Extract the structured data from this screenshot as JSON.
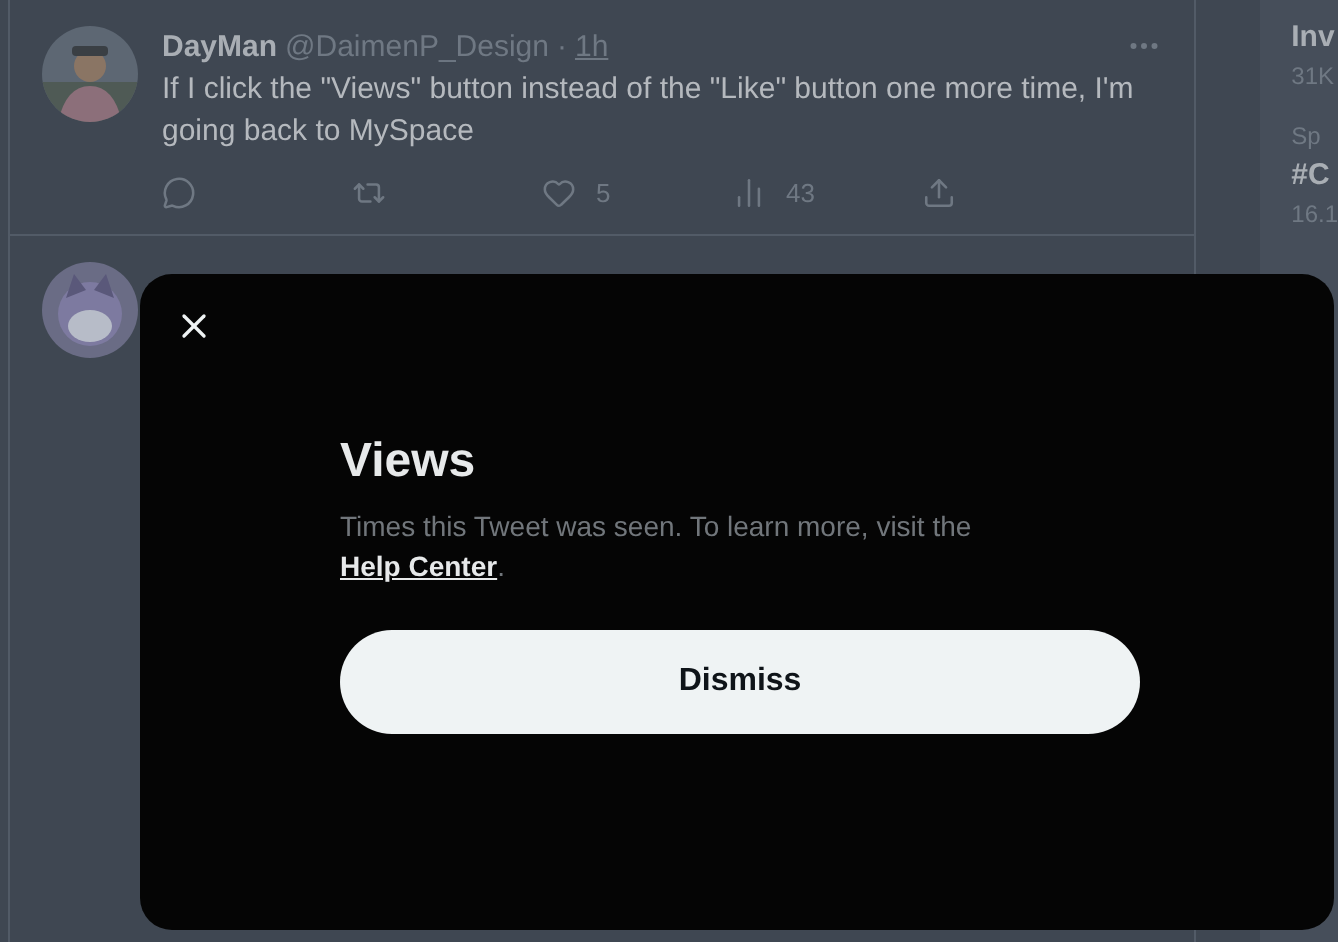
{
  "tweet": {
    "name": "DayMan",
    "handle": "@DaimenP_Design",
    "separator": "·",
    "time": "1h",
    "text": "If I click the \"Views\" button instead of the \"Like\" button one more time, I'm going back to MySpace",
    "actions": [
      {
        "kind": "reply"
      },
      {
        "kind": "retweet"
      },
      {
        "kind": "like",
        "count": "5"
      },
      {
        "kind": "views",
        "count": "43"
      },
      {
        "kind": "share"
      }
    ]
  },
  "sidebar": {
    "trends": [
      {
        "title": "Inv",
        "meta": "31K"
      },
      {
        "category": "Sp",
        "title": "#C",
        "meta": "16.1"
      }
    ]
  },
  "modal": {
    "title": "Views",
    "text": "Times this Tweet was seen. To learn more, visit the ",
    "link": "Help Center",
    "after": ".",
    "button": "Dismiss"
  }
}
